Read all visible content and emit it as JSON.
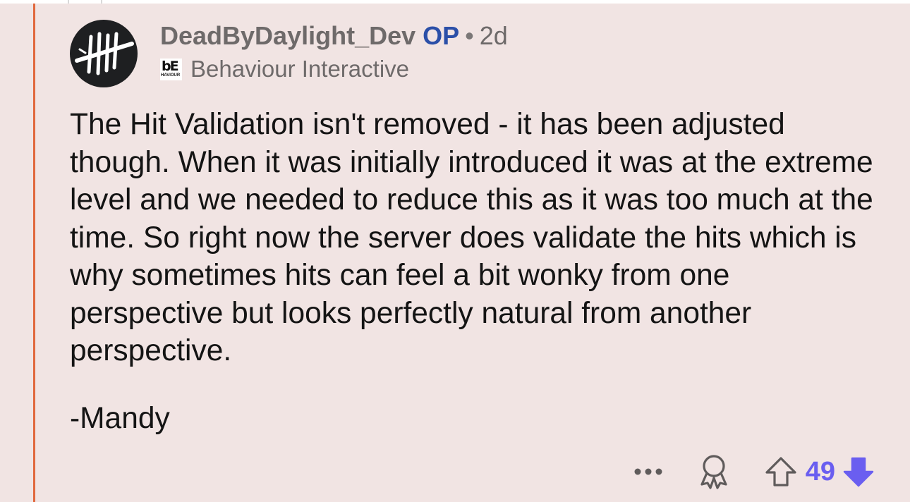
{
  "comment": {
    "author": "DeadByDaylight_Dev",
    "op_badge": "OP",
    "separator": "•",
    "age": "2d",
    "flair": {
      "logo_text": "bE",
      "logo_subtext": "HAVIOUR",
      "text": "Behaviour Interactive"
    },
    "body_paragraphs": [
      "The Hit Validation isn't removed - it has been adjusted though. When it was initially introduced it was at the extreme level and we needed to reduce this as it was too much at the time. So right now the server does validate the hits which is why sometimes hits can feel a bit wonky from one perspective but looks perfectly natural from another perspective.",
      "-Mandy"
    ],
    "actions": {
      "more_icon": "more-horizontal-icon",
      "award_icon": "award-icon",
      "upvote_icon": "upvote-arrow-icon",
      "score": "49",
      "downvote_icon": "downvote-arrow-icon"
    }
  },
  "colors": {
    "background": "#f1e4e3",
    "thread_line": "#e1683d",
    "op_badge": "#2b4fa8",
    "vote_accent": "#6a5ef0",
    "body_text": "#141414",
    "meta_text": "#6e6a6a"
  }
}
